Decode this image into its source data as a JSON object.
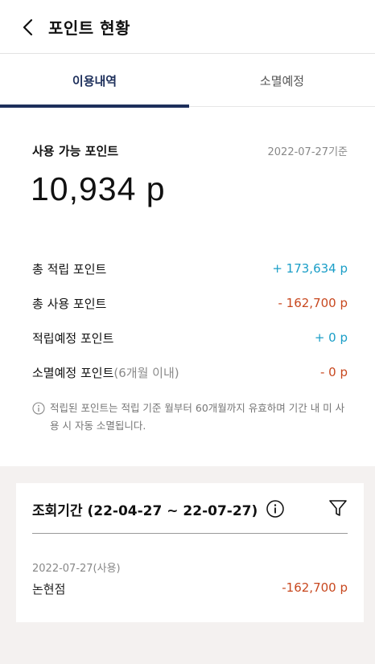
{
  "header": {
    "title": "포인트 현황"
  },
  "tabs": [
    {
      "label": "이용내역"
    },
    {
      "label": "소멸예정"
    }
  ],
  "summary": {
    "available_label": "사용 가능 포인트",
    "as_of": "2022-07-27기준",
    "available_value": "10,934 p",
    "rows": [
      {
        "label": "총 적립 포인트",
        "sub": "",
        "value": "+ 173,634 p"
      },
      {
        "label": "총 사용 포인트",
        "sub": "",
        "value": "- 162,700 p"
      },
      {
        "label": "적립예정 포인트",
        "sub": "",
        "value": "+ 0 p"
      },
      {
        "label": "소멸예정 포인트",
        "sub": "(6개월 이내)",
        "value": "- 0 p"
      }
    ],
    "notice": "적립된 포인트는 적립 기준 월부터 60개월까지 유효하며 기간 내 미 사용 시 자동 소멸됩니다."
  },
  "history": {
    "period": "조회기간 (22-04-27 ~ 22-07-27)",
    "transactions": [
      {
        "date": "2022-07-27(사용)",
        "store": "논현점",
        "amount": "-162,700 p"
      }
    ]
  },
  "colors": {
    "accent": "#1d2f5b",
    "positive": "#1a9ec7",
    "negative": "#c8481f",
    "section_bg": "#f4f1f0"
  },
  "icons": {
    "back": "chevron-left-icon",
    "info": "info-circle-icon",
    "filter": "filter-icon"
  }
}
